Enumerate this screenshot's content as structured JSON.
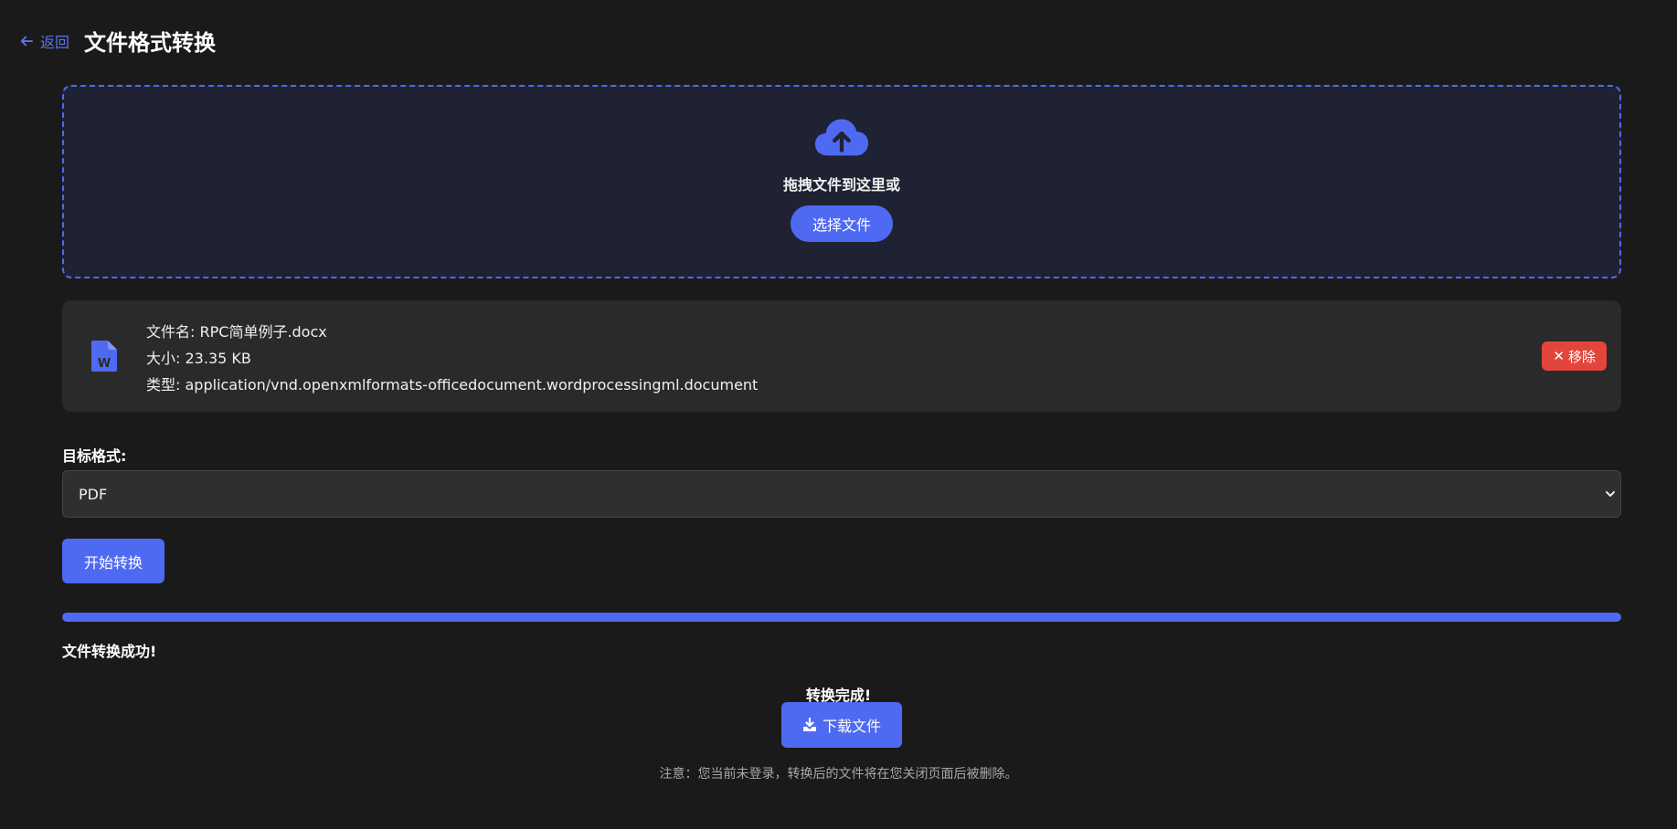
{
  "header": {
    "back_label": "返回",
    "title": "文件格式转换"
  },
  "dropzone": {
    "icon": "cloud-upload-icon",
    "text": "拖拽文件到这里或",
    "select_button": "选择文件"
  },
  "file": {
    "icon": "word-document-icon",
    "name_label": "文件名:",
    "name": "RPC简单例子.docx",
    "size_label": "大小:",
    "size": "23.35 KB",
    "type_label": "类型:",
    "type": "application/vnd.openxmlformats-officedocument.wordprocessingml.document",
    "remove_button": "移除"
  },
  "format": {
    "label": "目标格式:",
    "selected": "PDF"
  },
  "convert_button": "开始转换",
  "progress": {
    "percent": 100
  },
  "success_message": "文件转换成功!",
  "result": {
    "done_text": "转换完成!",
    "download_button": "下载文件",
    "notice": "注意：您当前未登录，转换后的文件将在您关闭页面后被删除。"
  },
  "colors": {
    "accent": "#4f6af2",
    "danger": "#e2453c",
    "background": "#1a1a1a"
  }
}
